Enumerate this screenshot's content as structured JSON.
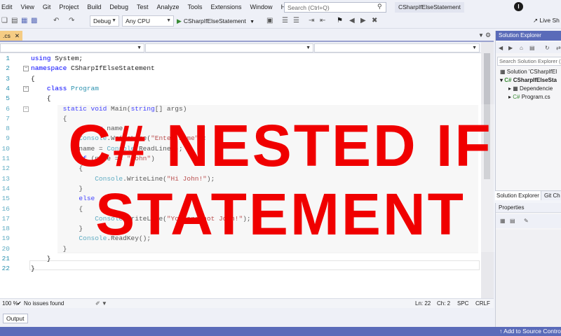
{
  "menu": {
    "items": [
      "Edit",
      "View",
      "Git",
      "Project",
      "Build",
      "Debug",
      "Test",
      "Analyze",
      "Tools",
      "Extensions",
      "Window",
      "Help"
    ]
  },
  "search": {
    "placeholder": "Search (Ctrl+Q)"
  },
  "solution_name": "CSharpIfElseStatement",
  "profile_initial": "I",
  "toolbar": {
    "config": "Debug",
    "platform": "Any CPU",
    "start_label": "CSharpIfElseStatement",
    "live_share": "Live Sh"
  },
  "tab": {
    "file_label": ".cs"
  },
  "code": {
    "line_numbers": [
      "1",
      "2",
      "3",
      "4",
      "5",
      "6",
      "7",
      "8",
      "9",
      "10",
      "11",
      "12",
      "13",
      "14",
      "15",
      "16",
      "17",
      "18",
      "19",
      "20",
      "21",
      "22"
    ],
    "lines": [
      "using System;",
      "namespace CSharpIfElseStatement",
      "{",
      "    class Program",
      "    {",
      "        static void Main(string[] args)",
      "        {",
      "            string name;",
      "            Console.WriteLine(\"Enter name\");",
      "            name = Console.ReadLine();",
      "            if (name == \"John\")",
      "            {",
      "                Console.WriteLine(\"Hi John!\");",
      "            }",
      "            else",
      "            {",
      "                Console.WriteLine(\"You are not John!\");",
      "            }",
      "            Console.ReadKey();",
      "        }",
      "    }",
      "}"
    ]
  },
  "overlay": {
    "line1": "C# NESTED IF",
    "line2": "STATEMENT"
  },
  "editor_status": {
    "zoom": "100 %",
    "issues": "No issues found",
    "line": "Ln: 22",
    "col": "Ch: 2",
    "spc": "SPC",
    "crlf": "CRLF"
  },
  "output_tab": "Output",
  "status_bar": {
    "source_control": "Add to Source Control"
  },
  "solution_explorer": {
    "title": "Solution Explorer",
    "search_placeholder": "Search Solution Explorer (",
    "solution_node": "Solution 'CSharpIfEl",
    "project_node": "CSharpIfElseSta",
    "dependencies_node": "Dependencie",
    "program_node": "Program.cs",
    "tab1": "Solution Explorer",
    "tab2": "Git Ch"
  },
  "properties": {
    "title": "Properties"
  },
  "colors": {
    "accent": "#5a6bb9",
    "title_red": "#f00000",
    "keyword": "#0000ff",
    "type": "#2b91af",
    "string": "#a31515"
  }
}
